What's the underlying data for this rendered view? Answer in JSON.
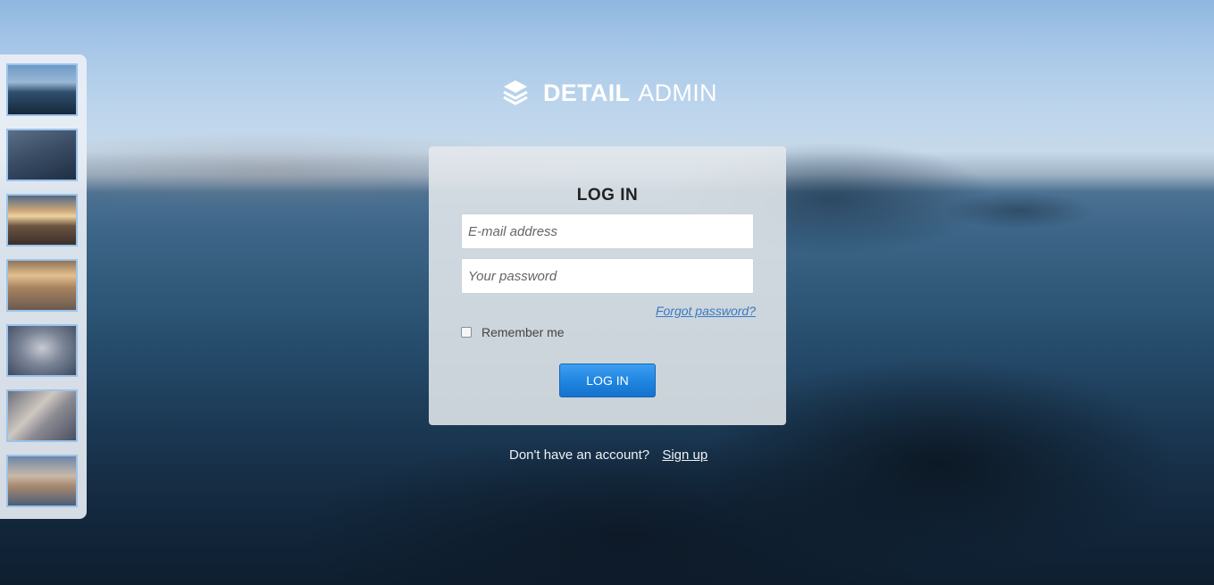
{
  "brand": {
    "bold": "DETAIL",
    "light": "ADMIN",
    "icon": "layers-icon"
  },
  "backgrounds": [
    {
      "name": "background-thumb-1"
    },
    {
      "name": "background-thumb-2"
    },
    {
      "name": "background-thumb-3"
    },
    {
      "name": "background-thumb-4"
    },
    {
      "name": "background-thumb-5"
    },
    {
      "name": "background-thumb-6"
    },
    {
      "name": "background-thumb-7"
    }
  ],
  "login": {
    "title": "LOG IN",
    "email_placeholder": "E-mail address",
    "email_value": "",
    "password_placeholder": "Your password",
    "password_value": "",
    "forgot_label": "Forgot password?",
    "remember_label": "Remember me",
    "remember_checked": false,
    "submit_label": "LOG IN"
  },
  "signup": {
    "prompt": "Don't have an account?",
    "link_label": "Sign up"
  },
  "colors": {
    "accent": "#1f84e0",
    "link": "#3a7ac2"
  }
}
